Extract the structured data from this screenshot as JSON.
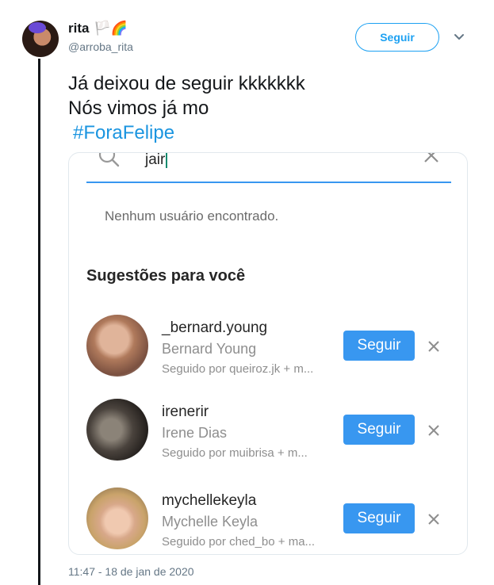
{
  "tweet": {
    "author_name": "rita",
    "author_flags": "🏳️🌈",
    "author_handle": "@arroba_rita",
    "follow_label": "Seguir",
    "text_lines": [
      "Já deixou de seguir kkkkkkk",
      "Nós vimos já mo"
    ],
    "hashtag": "#ForaFelipe",
    "timestamp": "11:47 - 18 de jan de 2020"
  },
  "screenshot": {
    "search_value": "jair",
    "empty_message": "Nenhum usuário encontrado.",
    "suggestions_title": "Sugestões para você",
    "suggestions": [
      {
        "username": "_bernard.young",
        "full_name": "Bernard Young",
        "followed_by": "Seguido por queiroz.jk + m...",
        "follow_label": "Seguir"
      },
      {
        "username": "irenerir",
        "full_name": "Irene Dias",
        "followed_by": "Seguido por muibrisa + m...",
        "follow_label": "Seguir"
      },
      {
        "username": "mychellekeyla",
        "full_name": "Mychelle Keyla",
        "followed_by": "Seguido por ched_bo + ma...",
        "follow_label": "Seguir"
      }
    ]
  },
  "colors": {
    "twitter_blue": "#1da1f2",
    "hashtag_blue": "#1b95e0",
    "instagram_blue": "#3897f0",
    "muted_gray": "#657786"
  },
  "icons": [
    "search-icon",
    "close-icon",
    "chevron-down-icon"
  ]
}
